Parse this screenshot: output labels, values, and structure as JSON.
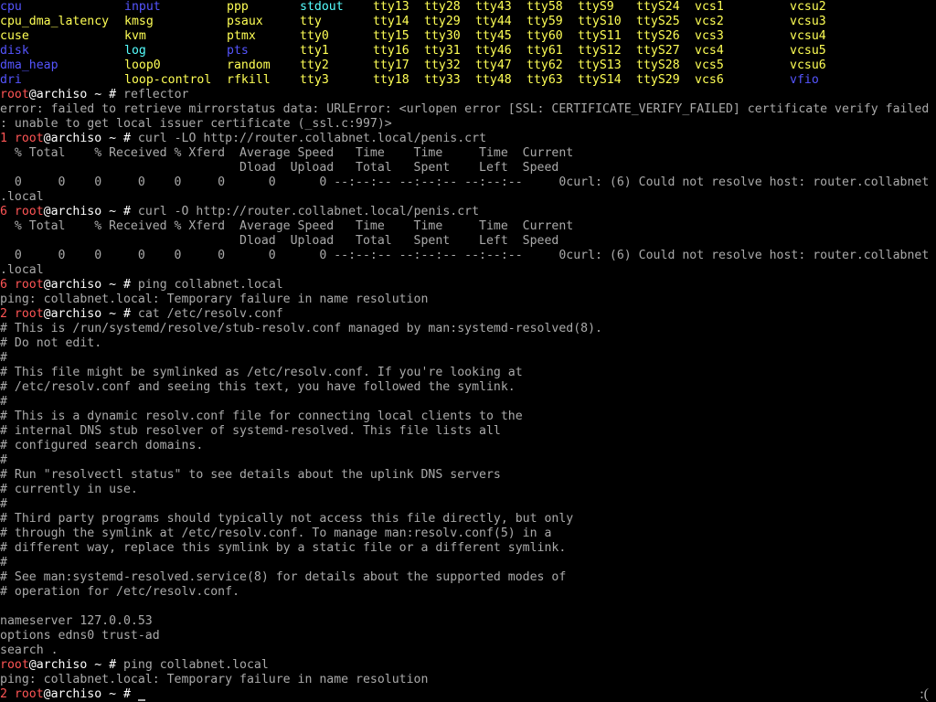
{
  "terminal": {
    "prompt": {
      "user": "root",
      "at_host": "@archiso",
      "path_sign": " ~ # "
    },
    "colors": {
      "background": "#000000",
      "text": "#aaaaaa",
      "white": "#ffffff",
      "device": "#ffff55",
      "link": "#55ffff",
      "directory": "#5555ff",
      "prompt_user": "#ff5555",
      "exit_code": "#ff5555"
    },
    "dev_listing": {
      "rows": [
        [
          {
            "text": "cpu",
            "color": "directory"
          },
          {
            "text": "input",
            "color": "directory"
          },
          {
            "text": "ppp",
            "color": "device"
          },
          {
            "text": "stdout",
            "color": "link"
          },
          {
            "text": "tty13",
            "color": "device"
          },
          {
            "text": "tty28",
            "color": "device"
          },
          {
            "text": "tty43",
            "color": "device"
          },
          {
            "text": "tty58",
            "color": "device"
          },
          {
            "text": "ttyS9",
            "color": "device"
          },
          {
            "text": "ttyS24",
            "color": "device"
          },
          {
            "text": "vcs1",
            "color": "device"
          },
          {
            "text": "vcsu2",
            "color": "device"
          }
        ],
        [
          {
            "text": "cpu_dma_latency",
            "color": "device"
          },
          {
            "text": "kmsg",
            "color": "device"
          },
          {
            "text": "psaux",
            "color": "device"
          },
          {
            "text": "tty",
            "color": "device"
          },
          {
            "text": "tty14",
            "color": "device"
          },
          {
            "text": "tty29",
            "color": "device"
          },
          {
            "text": "tty44",
            "color": "device"
          },
          {
            "text": "tty59",
            "color": "device"
          },
          {
            "text": "ttyS10",
            "color": "device"
          },
          {
            "text": "ttyS25",
            "color": "device"
          },
          {
            "text": "vcs2",
            "color": "device"
          },
          {
            "text": "vcsu3",
            "color": "device"
          }
        ],
        [
          {
            "text": "cuse",
            "color": "device"
          },
          {
            "text": "kvm",
            "color": "device"
          },
          {
            "text": "ptmx",
            "color": "device"
          },
          {
            "text": "tty0",
            "color": "device"
          },
          {
            "text": "tty15",
            "color": "device"
          },
          {
            "text": "tty30",
            "color": "device"
          },
          {
            "text": "tty45",
            "color": "device"
          },
          {
            "text": "tty60",
            "color": "device"
          },
          {
            "text": "ttyS11",
            "color": "device"
          },
          {
            "text": "ttyS26",
            "color": "device"
          },
          {
            "text": "vcs3",
            "color": "device"
          },
          {
            "text": "vcsu4",
            "color": "device"
          }
        ],
        [
          {
            "text": "disk",
            "color": "directory"
          },
          {
            "text": "log",
            "color": "link"
          },
          {
            "text": "pts",
            "color": "directory"
          },
          {
            "text": "tty1",
            "color": "device"
          },
          {
            "text": "tty16",
            "color": "device"
          },
          {
            "text": "tty31",
            "color": "device"
          },
          {
            "text": "tty46",
            "color": "device"
          },
          {
            "text": "tty61",
            "color": "device"
          },
          {
            "text": "ttyS12",
            "color": "device"
          },
          {
            "text": "ttyS27",
            "color": "device"
          },
          {
            "text": "vcs4",
            "color": "device"
          },
          {
            "text": "vcsu5",
            "color": "device"
          }
        ],
        [
          {
            "text": "dma_heap",
            "color": "directory"
          },
          {
            "text": "loop0",
            "color": "device"
          },
          {
            "text": "random",
            "color": "device"
          },
          {
            "text": "tty2",
            "color": "device"
          },
          {
            "text": "tty17",
            "color": "device"
          },
          {
            "text": "tty32",
            "color": "device"
          },
          {
            "text": "tty47",
            "color": "device"
          },
          {
            "text": "tty62",
            "color": "device"
          },
          {
            "text": "ttyS13",
            "color": "device"
          },
          {
            "text": "ttyS28",
            "color": "device"
          },
          {
            "text": "vcs5",
            "color": "device"
          },
          {
            "text": "vcsu6",
            "color": "device"
          }
        ],
        [
          {
            "text": "dri",
            "color": "directory"
          },
          {
            "text": "loop-control",
            "color": "device"
          },
          {
            "text": "rfkill",
            "color": "device"
          },
          {
            "text": "tty3",
            "color": "device"
          },
          {
            "text": "tty18",
            "color": "device"
          },
          {
            "text": "tty33",
            "color": "device"
          },
          {
            "text": "tty48",
            "color": "device"
          },
          {
            "text": "tty63",
            "color": "device"
          },
          {
            "text": "ttyS14",
            "color": "device"
          },
          {
            "text": "ttyS29",
            "color": "device"
          },
          {
            "text": "vcs6",
            "color": "device"
          },
          {
            "text": "vfio",
            "color": "directory"
          }
        ]
      ]
    },
    "lines": [
      {
        "type": "prompt",
        "code": "",
        "command": "reflector"
      },
      {
        "type": "output",
        "text": "error: failed to retrieve mirrorstatus data: URLError: <urlopen error [SSL: CERTIFICATE_VERIFY_FAILED] certificate verify failed"
      },
      {
        "type": "output",
        "text": ": unable to get local issuer certificate (_ssl.c:997)>"
      },
      {
        "type": "prompt",
        "code": "1",
        "command": "curl -LO http://router.collabnet.local/penis.crt"
      },
      {
        "type": "output",
        "text": "  % Total    % Received % Xferd  Average Speed   Time    Time     Time  Current"
      },
      {
        "type": "output",
        "text": "                                 Dload  Upload   Total   Spent    Left  Speed"
      },
      {
        "type": "output",
        "text": "  0     0    0     0    0     0      0      0 --:--:-- --:--:-- --:--:--     0curl: (6) Could not resolve host: router.collabnet"
      },
      {
        "type": "output",
        "text": ".local"
      },
      {
        "type": "prompt",
        "code": "6",
        "command": "curl -O http://router.collabnet.local/penis.crt"
      },
      {
        "type": "output",
        "text": "  % Total    % Received % Xferd  Average Speed   Time    Time     Time  Current"
      },
      {
        "type": "output",
        "text": "                                 Dload  Upload   Total   Spent    Left  Speed"
      },
      {
        "type": "output",
        "text": "  0     0    0     0    0     0      0      0 --:--:-- --:--:-- --:--:--     0curl: (6) Could not resolve host: router.collabnet"
      },
      {
        "type": "output",
        "text": ".local"
      },
      {
        "type": "prompt",
        "code": "6",
        "command": "ping collabnet.local"
      },
      {
        "type": "output",
        "text": "ping: collabnet.local: Temporary failure in name resolution"
      },
      {
        "type": "prompt",
        "code": "2",
        "command": "cat /etc/resolv.conf"
      },
      {
        "type": "output",
        "text": "# This is /run/systemd/resolve/stub-resolv.conf managed by man:systemd-resolved(8)."
      },
      {
        "type": "output",
        "text": "# Do not edit."
      },
      {
        "type": "output",
        "text": "#"
      },
      {
        "type": "output",
        "text": "# This file might be symlinked as /etc/resolv.conf. If you're looking at"
      },
      {
        "type": "output",
        "text": "# /etc/resolv.conf and seeing this text, you have followed the symlink."
      },
      {
        "type": "output",
        "text": "#"
      },
      {
        "type": "output",
        "text": "# This is a dynamic resolv.conf file for connecting local clients to the"
      },
      {
        "type": "output",
        "text": "# internal DNS stub resolver of systemd-resolved. This file lists all"
      },
      {
        "type": "output",
        "text": "# configured search domains."
      },
      {
        "type": "output",
        "text": "#"
      },
      {
        "type": "output",
        "text": "# Run \"resolvectl status\" to see details about the uplink DNS servers"
      },
      {
        "type": "output",
        "text": "# currently in use."
      },
      {
        "type": "output",
        "text": "#"
      },
      {
        "type": "output",
        "text": "# Third party programs should typically not access this file directly, but only"
      },
      {
        "type": "output",
        "text": "# through the symlink at /etc/resolv.conf. To manage man:resolv.conf(5) in a"
      },
      {
        "type": "output",
        "text": "# different way, replace this symlink by a static file or a different symlink."
      },
      {
        "type": "output",
        "text": "#"
      },
      {
        "type": "output",
        "text": "# See man:systemd-resolved.service(8) for details about the supported modes of"
      },
      {
        "type": "output",
        "text": "# operation for /etc/resolv.conf."
      },
      {
        "type": "output",
        "text": ""
      },
      {
        "type": "output",
        "text": "nameserver 127.0.0.53"
      },
      {
        "type": "output",
        "text": "options edns0 trust-ad"
      },
      {
        "type": "output",
        "text": "search ."
      },
      {
        "type": "prompt",
        "code": "",
        "command": "ping collabnet.local"
      },
      {
        "type": "output",
        "text": "ping: collabnet.local: Temporary failure in name resolution"
      },
      {
        "type": "prompt",
        "code": "2",
        "command": "",
        "cursor": true
      }
    ],
    "status_indicator": ":("
  }
}
